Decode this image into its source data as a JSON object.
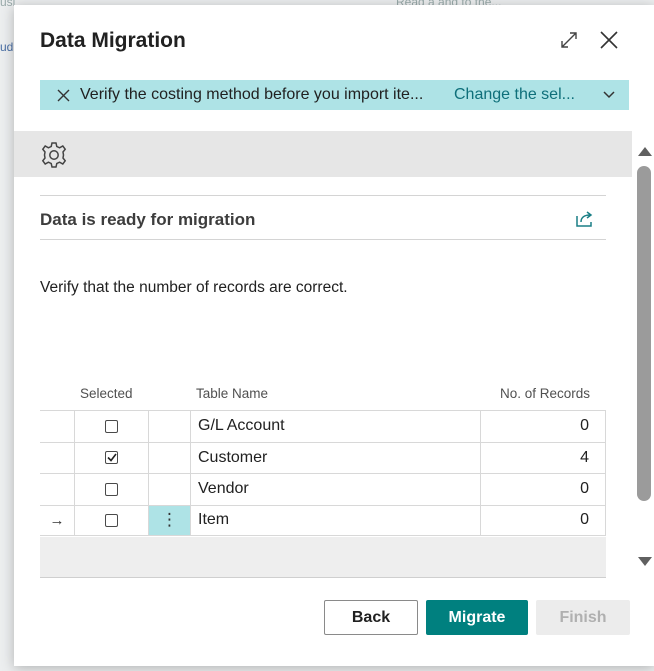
{
  "backdrop": {
    "left_text": "ud",
    "top_left_text": "usi",
    "top_right_text": "Read a and to the..."
  },
  "dialog": {
    "title": "Data Migration",
    "icons": {
      "expand": "expand-icon",
      "close": "close-icon"
    }
  },
  "notification": {
    "message": "Verify the costing method before you import ite...",
    "action": "Change the sel...",
    "colors": {
      "background": "#aee3e6",
      "action": "#0e6f7a"
    }
  },
  "section": {
    "title": "Data is ready for migration",
    "instruction": "Verify that the number of records are correct."
  },
  "table": {
    "headers": {
      "selected": "Selected",
      "name": "Table Name",
      "records": "No. of Records"
    },
    "rows": [
      {
        "indicator": "",
        "selected": false,
        "name": "G/L Account",
        "records": "0"
      },
      {
        "indicator": "",
        "selected": true,
        "name": "Customer",
        "records": "4"
      },
      {
        "indicator": "",
        "selected": false,
        "name": "Vendor",
        "records": "0"
      },
      {
        "indicator": "→",
        "selected": false,
        "name": "Item",
        "records": "0",
        "active": true,
        "action_glyph": "⋮"
      }
    ]
  },
  "buttons": {
    "back": "Back",
    "migrate": "Migrate",
    "finish": "Finish",
    "colors": {
      "primary": "#00807f",
      "disabled_bg": "#ececec",
      "disabled_text": "#b0b0b0"
    }
  }
}
